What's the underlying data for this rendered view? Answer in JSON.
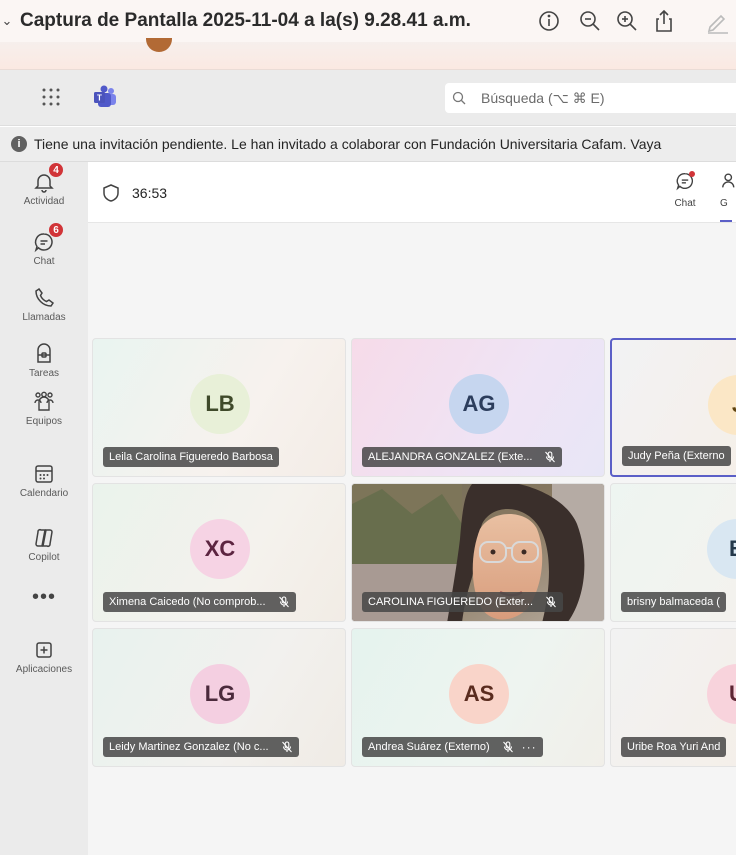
{
  "window": {
    "title": "Captura de Pantalla 2025-11-04 a la(s) 9.28.41 a.m."
  },
  "topbar": {
    "search_placeholder": "Búsqueda (⌥ ⌘ E)"
  },
  "notice": {
    "text": "Tiene una invitación pendiente. Le han invitado a colaborar con Fundación Universitaria Cafam. Vaya"
  },
  "rail": {
    "items": [
      {
        "label": "Actividad",
        "badge": "4"
      },
      {
        "label": "Chat",
        "badge": "6"
      },
      {
        "label": "Llamadas"
      },
      {
        "label": "Tareas"
      },
      {
        "label": "Equipos"
      },
      {
        "label": "Calendario"
      },
      {
        "label": "Copilot"
      },
      {
        "label": "•••"
      },
      {
        "label": "Aplicaciones"
      }
    ]
  },
  "meeting": {
    "timer": "36:53",
    "chat_label": "Chat",
    "people_label": "G",
    "participants": [
      {
        "initials": "LB",
        "name": "Leila Carolina Figueredo Barbosa",
        "avatar_color": "#e8f0d8",
        "text_color": "#3f4a2a"
      },
      {
        "initials": "AG",
        "name": "ALEJANDRA GONZALEZ (Exte...",
        "avatar_color": "#c6d6ef",
        "text_color": "#2c3d5c",
        "muted": true
      },
      {
        "initials": "J",
        "name": "Judy Peña (Externo",
        "avatar_color": "#fbe7c6",
        "text_color": "#5e4310"
      },
      {
        "initials": "XC",
        "name": "Ximena Caicedo (No comprob...",
        "avatar_color": "#f6d3e4",
        "text_color": "#5c2440",
        "muted": true
      },
      {
        "initials": "",
        "name": "CAROLINA FIGUEREDO (Exter...",
        "muted": true,
        "photo": true
      },
      {
        "initials": "B",
        "name": "brisny balmaceda (",
        "avatar_color": "#d9e7f2",
        "text_color": "#24384a"
      },
      {
        "initials": "LG",
        "name": "Leidy Martinez Gonzalez (No c...",
        "avatar_color": "#f4cfe1",
        "text_color": "#4b2a3c",
        "muted": true
      },
      {
        "initials": "AS",
        "name": "Andrea Suárez (Externo)",
        "avatar_color": "#f9d4c9",
        "text_color": "#5a2c1f",
        "muted": true,
        "more": "···"
      },
      {
        "initials": "U",
        "name": "Uribe Roa Yuri And",
        "avatar_color": "#f8d3dc",
        "text_color": "#5c2533"
      }
    ]
  }
}
